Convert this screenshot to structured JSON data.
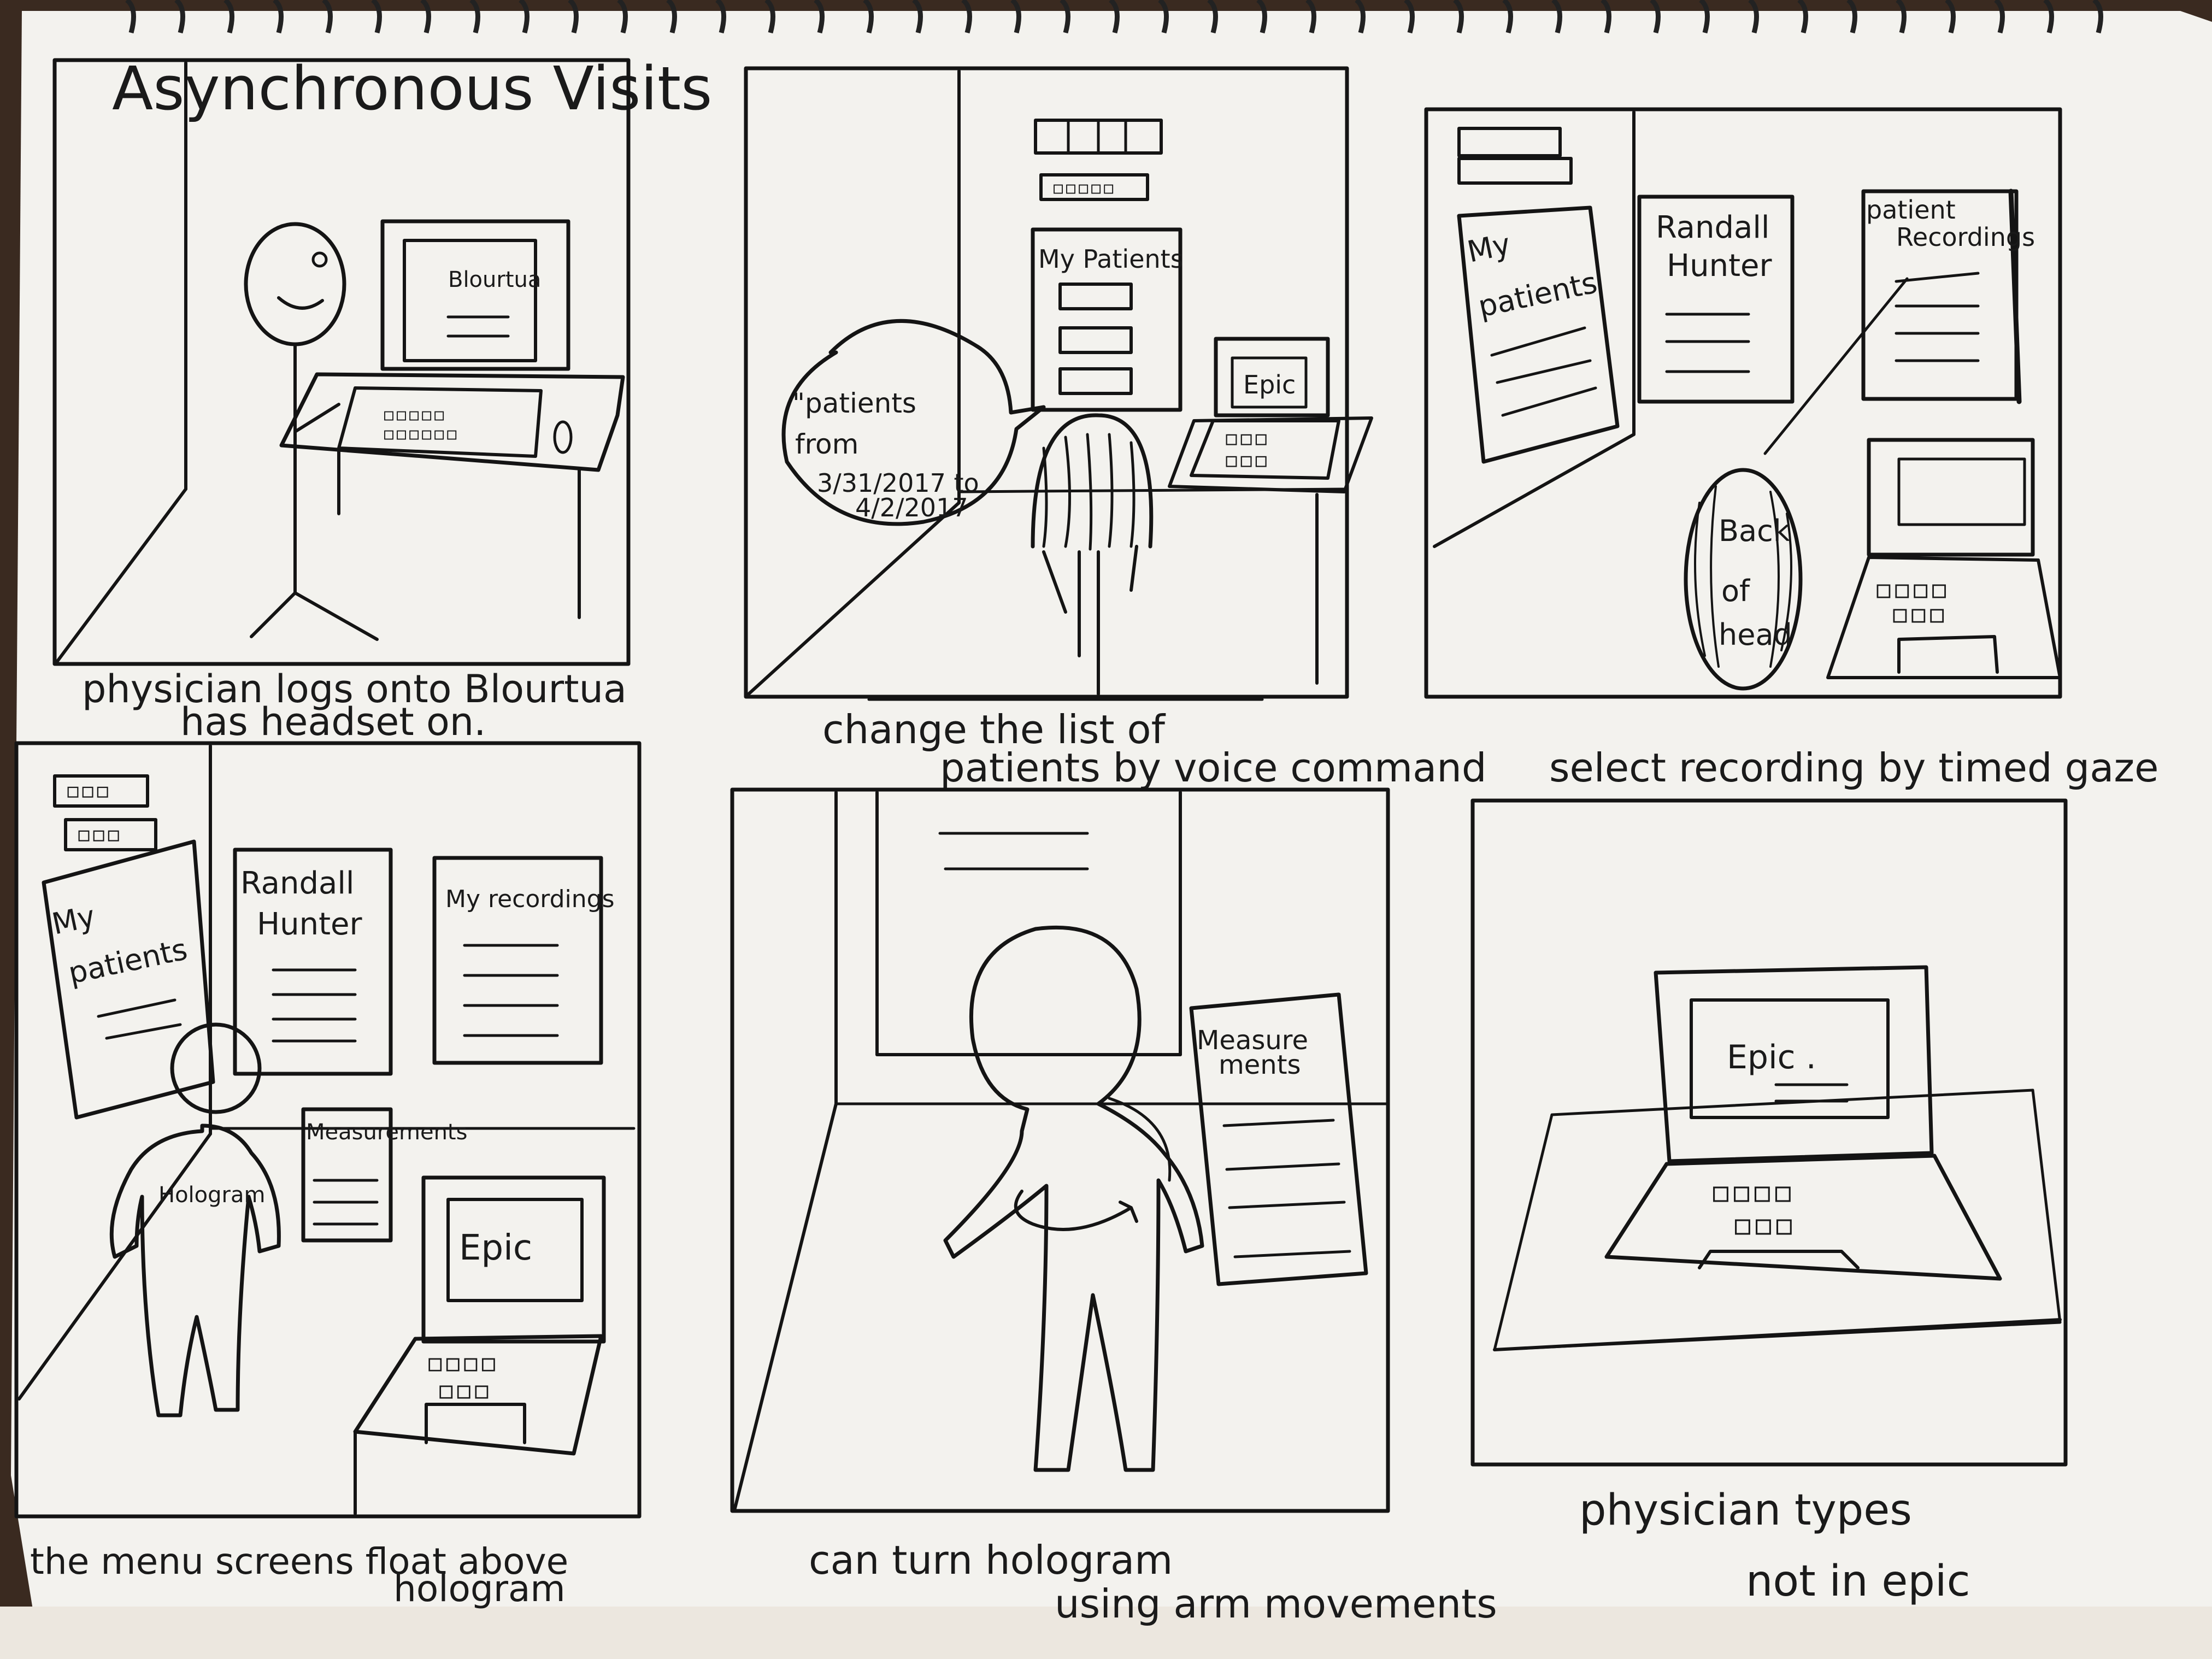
{
  "title": "Asynchronous Visits",
  "panels": [
    {
      "caption_lines": [
        "physician logs onto Blourtua",
        "has headset on."
      ],
      "screen_text": "Blourtua"
    },
    {
      "caption_lines": [
        "change the list of",
        "patients by voice command"
      ],
      "menu_title": "My Patients",
      "monitor_text": "Epic",
      "speech_lines": [
        "\"patients",
        "from",
        "3/31/2017 to",
        "4/2/2017"
      ]
    },
    {
      "caption_lines": [
        "select recording by timed gaze"
      ],
      "card_my_patients": [
        "My",
        "patients"
      ],
      "card_patient": [
        "Randall",
        "Hunter"
      ],
      "card_recordings": [
        "patient",
        "Recordings"
      ],
      "head_lines": [
        "Back",
        "of",
        "head"
      ]
    },
    {
      "caption_lines": [
        "the menu screens float above",
        "hologram"
      ],
      "card_my_patients": [
        "My",
        "patients"
      ],
      "card_patient": [
        "Randall",
        "Hunter"
      ],
      "card_recordings": "My recordings",
      "card_measurements": "Measurements",
      "figure_label": "Hologram",
      "monitor_text": "Epic"
    },
    {
      "caption_lines": [
        "can turn hologram",
        "using arm movements"
      ],
      "card_measurements": [
        "Measure",
        "ments"
      ]
    },
    {
      "caption_lines": [
        "physician types",
        "not in epic"
      ],
      "monitor_text": "Epic ."
    }
  ]
}
